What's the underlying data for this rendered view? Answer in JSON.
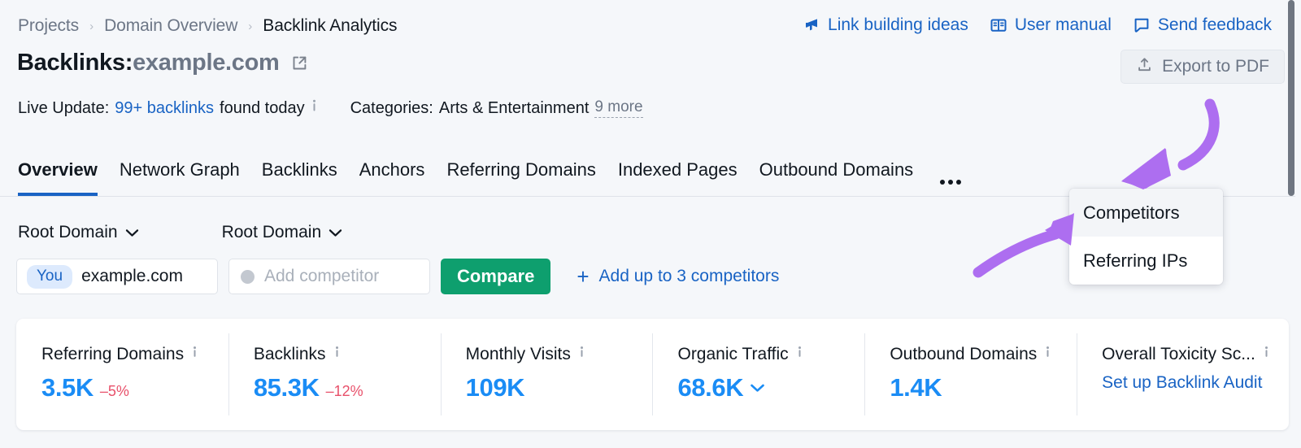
{
  "breadcrumb": {
    "items": [
      {
        "label": "Projects",
        "current": false
      },
      {
        "label": "Domain Overview",
        "current": false
      },
      {
        "label": "Backlink Analytics",
        "current": true
      }
    ],
    "separator": "›"
  },
  "header": {
    "title_prefix": "Backlinks:",
    "title_domain": "example.com",
    "external_link_icon": "external-link-icon"
  },
  "top_links": [
    {
      "label": "Link building ideas",
      "icon": "megaphone-icon"
    },
    {
      "label": "User manual",
      "icon": "book-icon"
    },
    {
      "label": "Send feedback",
      "icon": "message-icon"
    }
  ],
  "export": {
    "label": "Export to PDF",
    "icon": "upload-icon"
  },
  "meta": {
    "live_update_label": "Live Update:",
    "live_update_value": "99+ backlinks",
    "live_update_suffix": "found today",
    "info_icon": "info-icon",
    "categories_label": "Categories:",
    "categories_value": "Arts & Entertainment",
    "categories_more": "9 more"
  },
  "tabs": {
    "items": [
      {
        "label": "Overview",
        "active": true
      },
      {
        "label": "Network Graph",
        "active": false
      },
      {
        "label": "Backlinks",
        "active": false
      },
      {
        "label": "Anchors",
        "active": false
      },
      {
        "label": "Referring Domains",
        "active": false
      },
      {
        "label": "Indexed Pages",
        "active": false
      },
      {
        "label": "Outbound Domains",
        "active": false
      }
    ],
    "overflow_icon": "ellipsis-icon"
  },
  "menu": {
    "items": [
      {
        "label": "Competitors",
        "hover": true
      },
      {
        "label": "Referring IPs",
        "hover": false
      }
    ]
  },
  "compare": {
    "scope_one": "Root Domain",
    "scope_two": "Root Domain",
    "caret_icon": "chevron-down-icon",
    "you_badge": "You",
    "domain_value": "example.com",
    "competitor_placeholder": "Add competitor",
    "compare_button": "Compare",
    "add_competitors_label": "Add up to 3 competitors",
    "add_plus": "+"
  },
  "metrics": [
    {
      "label": "Referring Domains",
      "value": "3.5K",
      "delta": "–5%",
      "link": null,
      "caret": false
    },
    {
      "label": "Backlinks",
      "value": "85.3K",
      "delta": "–12%",
      "link": null,
      "caret": false
    },
    {
      "label": "Monthly Visits",
      "value": "109K",
      "delta": null,
      "link": null,
      "caret": false
    },
    {
      "label": "Organic Traffic",
      "value": "68.6K",
      "delta": null,
      "link": null,
      "caret": true
    },
    {
      "label": "Outbound Domains",
      "value": "1.4K",
      "delta": null,
      "link": null,
      "caret": false
    },
    {
      "label": "Overall Toxicity Sc...",
      "value": null,
      "delta": null,
      "link": "Set up Backlink Audit",
      "caret": false
    }
  ],
  "annotations": {
    "arrow_color": "#ad6ef0",
    "arrows": [
      {
        "name": "arrow-to-ellipsis-menu"
      },
      {
        "name": "arrow-to-competitors-item"
      }
    ]
  },
  "colors": {
    "page_background": "#f5f7fa",
    "card_background": "#ffffff",
    "link_blue": "#1963c4",
    "metric_blue": "#1a8cf5",
    "delta_red": "#e8506a",
    "compare_green": "#0e9f6e",
    "badge_blue_bg": "#ddeafd",
    "arrow_purple": "#ad6ef0",
    "tab_underline": "#1963c4"
  },
  "scrollbar": {
    "name": "vertical-scrollbar"
  }
}
